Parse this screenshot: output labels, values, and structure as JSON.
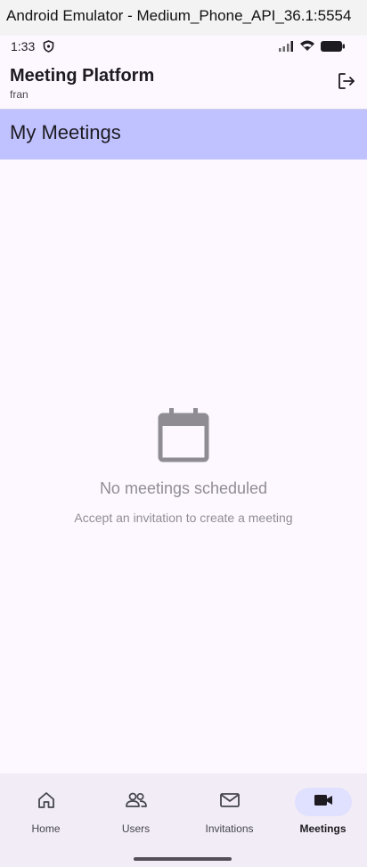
{
  "window": {
    "title": "Android Emulator - Medium_Phone_API_36.1:5554"
  },
  "status_bar": {
    "time": "1:33",
    "icons": [
      "shield-icon",
      "signal-icon",
      "wifi-icon",
      "battery-icon"
    ]
  },
  "app_bar": {
    "title": "Meeting Platform",
    "subtitle": "fran",
    "action_icon": "logout-icon"
  },
  "section": {
    "title": "My Meetings"
  },
  "empty_state": {
    "icon": "calendar-icon",
    "title": "No meetings scheduled",
    "subtitle": "Accept an invitation to create a meeting"
  },
  "bottom_nav": {
    "items": [
      {
        "label": "Home",
        "icon": "home-icon",
        "active": false
      },
      {
        "label": "Users",
        "icon": "users-icon",
        "active": false
      },
      {
        "label": "Invitations",
        "icon": "mail-icon",
        "active": false
      },
      {
        "label": "Meetings",
        "icon": "video-camera-icon",
        "active": true
      }
    ]
  },
  "colors": {
    "background": "#fdf8ff",
    "section_header": "#c0c1ff",
    "nav_background": "#f2ecf6",
    "active_pill": "#e0e0ff",
    "muted_text": "#8f8d93"
  }
}
